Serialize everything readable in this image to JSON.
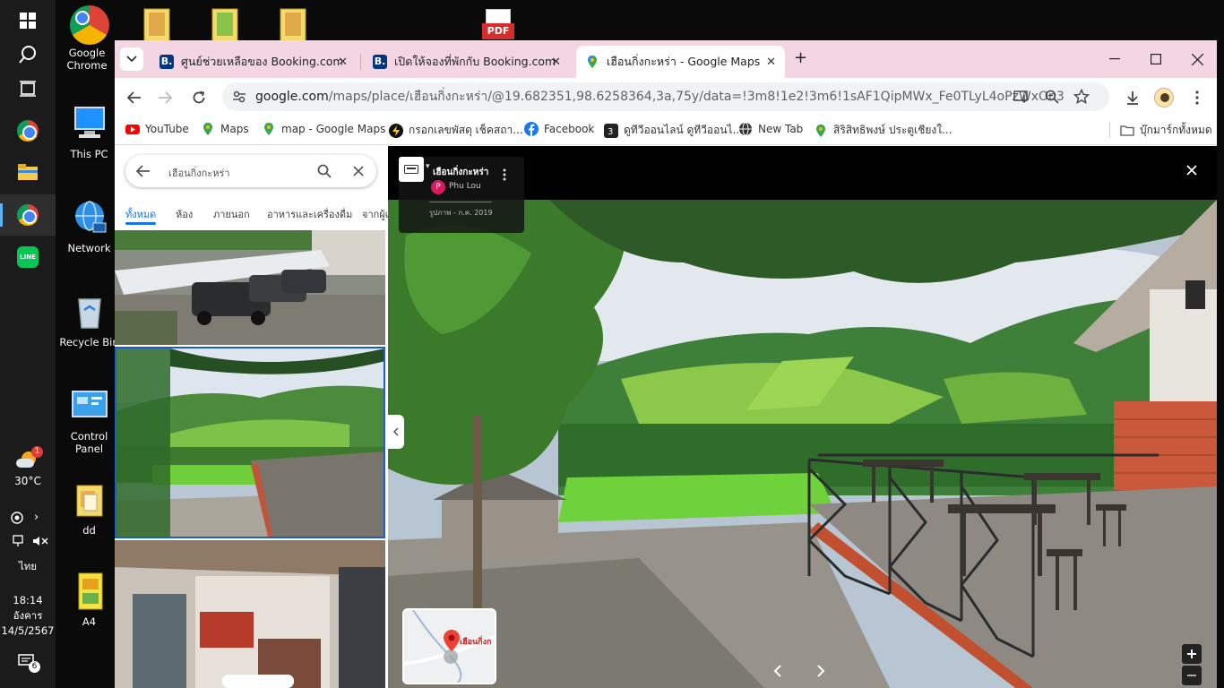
{
  "desktop": {
    "icons": [
      {
        "label": "Google Chrome"
      },
      {
        "label": "This PC"
      },
      {
        "label": "Network"
      },
      {
        "label": "Recycle Bin"
      },
      {
        "label": "Control Panel"
      },
      {
        "label": "dd"
      },
      {
        "label": "A4"
      }
    ],
    "top_file_label": "PDF"
  },
  "taskbar": {
    "weather_temp": "30°C",
    "weather_badge": "1",
    "language": "ไทย",
    "time": "18:14",
    "day": "อังคาร",
    "date": "14/5/2567",
    "notifications": "6"
  },
  "browser": {
    "tabs": [
      {
        "label": "ศูนย์ช่วยเหลือของ Booking.com",
        "favicon": "B."
      },
      {
        "label": "เปิดให้จองที่พักกับ Booking.com",
        "favicon": "B."
      },
      {
        "label": "เฮือนกิ่งกะหร่า - Google Maps",
        "favicon": "maps-pin"
      }
    ],
    "new_tab_symbol": "+",
    "address": {
      "host": "google.com",
      "path": "/maps/place/เฮือนกิ่งกะหร่า/@19.682351,98.6258364,3a,75y/data=!3m8!1e2!3m6!1sAF1QipMWx_Fe0TLyL4oPzWxOn34epwqN..."
    },
    "bookmarks": [
      {
        "label": "YouTube",
        "color": "#ff0000"
      },
      {
        "label": "Maps",
        "color": "#34a853"
      },
      {
        "label": "map - Google Maps",
        "color": "#34a853"
      },
      {
        "label": "กรอกเลขพัสดุ เช็คสถา...",
        "color": "#111111"
      },
      {
        "label": "Facebook",
        "color": "#1877f2"
      },
      {
        "label": "ดูทีวีออนไลน์ ดูทีวีออนไ...",
        "color": "#222222"
      },
      {
        "label": "New Tab",
        "color": "#333333"
      },
      {
        "label": "สิริสิทธิพงษ์ ประตูเชียงใ...",
        "color": "#34a853"
      }
    ],
    "all_bookmarks": "บุ๊กมาร์กทั้งหมด"
  },
  "maps": {
    "search_value": "เฮือนกิ่งกะหร่า",
    "categories": [
      "ทั้งหมด",
      "ห้อง",
      "ภายนอก",
      "อาหารและเครื่องดื่ม",
      "จากผู้เ"
    ],
    "viewer": {
      "place_name": "เฮือนกิ่งกะหร่า",
      "author_initial": "P",
      "author": "Phu Lou",
      "date": "รูปภาพ - ก.ค. 2019"
    },
    "minimap_label": "เฮือนกิ่งก"
  }
}
